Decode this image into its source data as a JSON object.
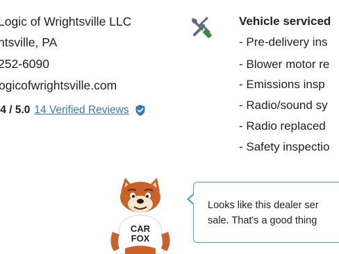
{
  "dealer": {
    "name_line": "Logic of Wrightsville LLC",
    "location_line": "htsville, PA",
    "phone_line": "252-6090",
    "website_line": "ogicofwrightsville.com",
    "rating_score": ".4 / 5.0",
    "reviews_link": "14 Verified Reviews",
    "verified_icon": "shield-check-icon"
  },
  "service": {
    "icon": "wrench-screwdriver-icon",
    "heading": "Vehicle serviced",
    "items": [
      "- Pre-delivery ins",
      "- Blower motor re",
      "- Emissions insp",
      "- Radio/sound sy",
      "- Radio replaced",
      "- Safety inspectio"
    ]
  },
  "mascot": {
    "shirt_line1": "CAR",
    "shirt_line2": "FOX"
  },
  "bubble": {
    "line1": "Looks like this dealer ser",
    "line2": "sale. That's a good thing"
  },
  "colors": {
    "link": "#3777bc",
    "badge": "#3777bc",
    "bubble_border": "#41a5dc",
    "tool_green": "#3b8d3b",
    "tool_gray": "#5f6b73",
    "fox_orange": "#c8622a"
  }
}
